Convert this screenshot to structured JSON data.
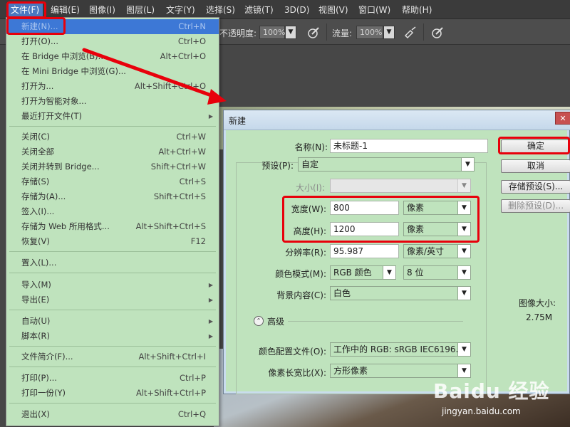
{
  "menubar": {
    "items": [
      "文件(F)",
      "编辑(E)",
      "图像(I)",
      "图层(L)",
      "文字(Y)",
      "选择(S)",
      "滤镜(T)",
      "3D(D)",
      "视图(V)",
      "窗口(W)",
      "帮助(H)"
    ]
  },
  "optionsbar": {
    "opacity_label": "不透明度:",
    "opacity_value": "100%",
    "flow_label": "流量:",
    "flow_value": "100%"
  },
  "file_menu": {
    "items": [
      {
        "label": "新建(N)...",
        "shortcut": "Ctrl+N"
      },
      {
        "label": "打开(O)...",
        "shortcut": "Ctrl+O"
      },
      {
        "label": "在 Bridge 中浏览(B)...",
        "shortcut": "Alt+Ctrl+O"
      },
      {
        "label": "在 Mini Bridge 中浏览(G)...",
        "shortcut": ""
      },
      {
        "label": "打开为...",
        "shortcut": "Alt+Shift+Ctrl+O"
      },
      {
        "label": "打开为智能对象...",
        "shortcut": ""
      },
      {
        "label": "最近打开文件(T)",
        "shortcut": ""
      },
      {
        "label": "关闭(C)",
        "shortcut": "Ctrl+W"
      },
      {
        "label": "关闭全部",
        "shortcut": "Alt+Ctrl+W"
      },
      {
        "label": "关闭并转到 Bridge...",
        "shortcut": "Shift+Ctrl+W"
      },
      {
        "label": "存储(S)",
        "shortcut": "Ctrl+S"
      },
      {
        "label": "存储为(A)...",
        "shortcut": "Shift+Ctrl+S"
      },
      {
        "label": "签入(I)...",
        "shortcut": ""
      },
      {
        "label": "存储为 Web 所用格式...",
        "shortcut": "Alt+Shift+Ctrl+S"
      },
      {
        "label": "恢复(V)",
        "shortcut": "F12"
      },
      {
        "label": "置入(L)...",
        "shortcut": ""
      },
      {
        "label": "导入(M)",
        "shortcut": ""
      },
      {
        "label": "导出(E)",
        "shortcut": ""
      },
      {
        "label": "自动(U)",
        "shortcut": ""
      },
      {
        "label": "脚本(R)",
        "shortcut": ""
      },
      {
        "label": "文件简介(F)...",
        "shortcut": "Alt+Shift+Ctrl+I"
      },
      {
        "label": "打印(P)...",
        "shortcut": "Ctrl+P"
      },
      {
        "label": "打印一份(Y)",
        "shortcut": "Alt+Shift+Ctrl+P"
      },
      {
        "label": "退出(X)",
        "shortcut": "Ctrl+Q"
      }
    ]
  },
  "dialog": {
    "title": "新建",
    "close": "✕",
    "name_label": "名称(N):",
    "name_value": "未标题-1",
    "preset_label": "预设(P):",
    "preset_value": "自定",
    "size_label": "大小(I):",
    "size_value": "",
    "width_label": "宽度(W):",
    "width_value": "800",
    "width_unit": "像素",
    "height_label": "高度(H):",
    "height_value": "1200",
    "height_unit": "像素",
    "resolution_label": "分辨率(R):",
    "resolution_value": "95.987",
    "resolution_unit": "像素/英寸",
    "color_mode_label": "颜色模式(M):",
    "color_mode_value": "RGB 颜色",
    "bit_depth_value": "8 位",
    "background_label": "背景内容(C):",
    "background_value": "白色",
    "advanced_label": "高级",
    "color_profile_label": "颜色配置文件(O):",
    "color_profile_value": "工作中的 RGB: sRGB IEC6196...",
    "pixel_aspect_label": "像素长宽比(X):",
    "pixel_aspect_value": "方形像素",
    "ok_button": "确定",
    "cancel_button": "取消",
    "save_preset_button": "存储预设(S)...",
    "delete_preset_button": "删除预设(D)...",
    "image_size_label": "图像大小:",
    "image_size_value": "2.75M"
  },
  "watermark": {
    "brand": "Baidu 经验",
    "url": "jingyan.baidu.com"
  }
}
